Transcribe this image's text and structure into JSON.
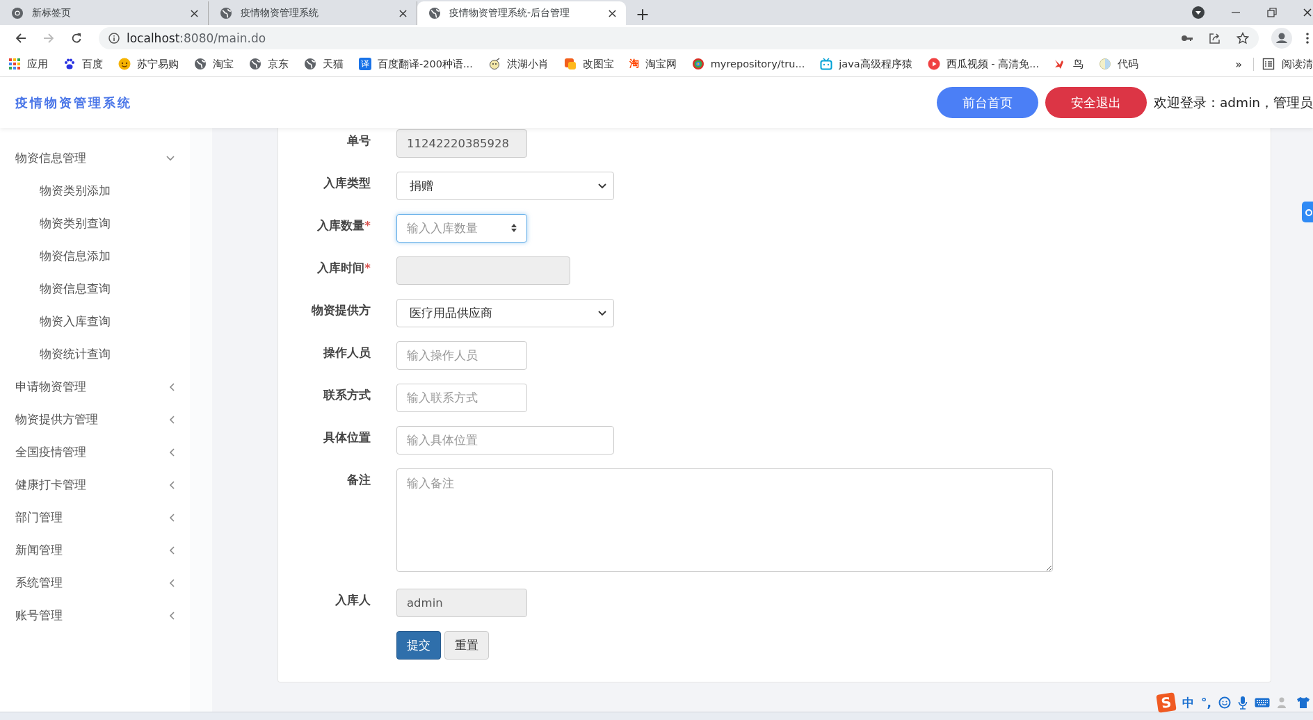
{
  "browser": {
    "tabs": [
      {
        "title": "新标签页",
        "kind": "chrome",
        "selected": false
      },
      {
        "title": "疫情物资管理系统",
        "kind": "globe",
        "selected": false
      },
      {
        "title": "疫情物资管理系统-后台管理",
        "kind": "globe",
        "selected": true
      }
    ],
    "new_tab": "+",
    "url_host": "localhost",
    "url_rest": ":8080/main.do",
    "bookmarks": [
      {
        "label": "应用",
        "kind": "apps"
      },
      {
        "label": "百度",
        "kind": "paw"
      },
      {
        "label": "苏宁易购",
        "kind": "smiley"
      },
      {
        "label": "淘宝",
        "kind": "globe"
      },
      {
        "label": "京东",
        "kind": "globe"
      },
      {
        "label": "天猫",
        "kind": "globe"
      },
      {
        "label": "百度翻译-200种语...",
        "kind": "badge",
        "badge": "译"
      },
      {
        "label": "洪湖小肖",
        "kind": "cartoon"
      },
      {
        "label": "改图宝",
        "kind": "square"
      },
      {
        "label": "淘宝网",
        "kind": "glyph",
        "badge": "淘"
      },
      {
        "label": "myrepository/tru...",
        "kind": "ring"
      },
      {
        "label": "java高级程序猿",
        "kind": "tv"
      },
      {
        "label": "西瓜视频 - 高清免...",
        "kind": "play"
      },
      {
        "label": "鸟",
        "kind": "bird"
      },
      {
        "label": "代码",
        "kind": "half"
      }
    ],
    "overflow": "»",
    "reading_list": "阅读清"
  },
  "header": {
    "title": "疫情物资管理系统",
    "buttons": [
      {
        "label": "前台首页",
        "kind": "primary"
      },
      {
        "label": "安全退出",
        "kind": "danger"
      }
    ],
    "welcome": "欢迎登录：admin，管理员"
  },
  "sidebar": {
    "groups": [
      {
        "label": "物资信息管理",
        "expanded": true,
        "children": [
          {
            "label": "物资类别添加"
          },
          {
            "label": "物资类别查询"
          },
          {
            "label": "物资信息添加"
          },
          {
            "label": "物资信息查询"
          },
          {
            "label": "物资入库查询"
          },
          {
            "label": "物资统计查询"
          }
        ]
      },
      {
        "label": "申请物资管理",
        "expanded": false
      },
      {
        "label": "物资提供方管理",
        "expanded": false
      },
      {
        "label": "全国疫情管理",
        "expanded": false
      },
      {
        "label": "健康打卡管理",
        "expanded": false
      },
      {
        "label": "部门管理",
        "expanded": false
      },
      {
        "label": "新闻管理",
        "expanded": false
      },
      {
        "label": "系统管理",
        "expanded": false
      },
      {
        "label": "账号管理",
        "expanded": false
      }
    ]
  },
  "form": {
    "fields": [
      {
        "label": "单号",
        "kind": "readonly",
        "value": "11242220385928"
      },
      {
        "label": "入库类型",
        "kind": "select",
        "value": "捐赠"
      },
      {
        "label": "入库数量",
        "kind": "number",
        "mark": "*",
        "placeholder": "输入入库数量"
      },
      {
        "label": "入库时间",
        "kind": "readonly",
        "mark": "*"
      },
      {
        "label": "物资提供方",
        "kind": "select",
        "value": "医疗用品供应商"
      },
      {
        "label": "操作人员",
        "kind": "text",
        "placeholder": "输入操作人员"
      },
      {
        "label": "联系方式",
        "kind": "text",
        "placeholder": "输入联系方式"
      },
      {
        "label": "具体位置",
        "kind": "wide",
        "placeholder": "输入具体位置"
      },
      {
        "label": "备注",
        "kind": "textarea",
        "placeholder": "输入备注"
      },
      {
        "label": "入库人",
        "kind": "readonly",
        "value": "admin"
      }
    ],
    "buttons": [
      {
        "label": "提交",
        "kind": "primary"
      },
      {
        "label": "重置",
        "kind": "default"
      }
    ]
  },
  "ime": {
    "logo": "S",
    "mode": "中",
    "punct": "°,"
  }
}
